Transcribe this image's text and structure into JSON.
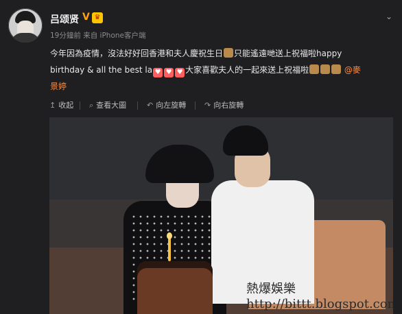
{
  "post": {
    "username": "吕颂贤",
    "verified_mark": "V",
    "crown_badge": "♛",
    "meta": "19分鐘前 来自 iPhone客户端",
    "chevron": "⌄",
    "content": {
      "line1": "今年因為疫情，沒法好好回香港和夫人慶祝生日",
      "line1b": "只能遙遠哋送上祝福啦happy",
      "line2a": "birthday & all the best la",
      "line2b": "大家喜歡夫人的一起來送上祝福啦",
      "mention": "@麥",
      "line3": "景婷"
    }
  },
  "actions": {
    "collapse": "收起",
    "view_large": "查看大圖",
    "rotate_left": "向左旋轉",
    "rotate_right": "向右旋轉"
  },
  "photo": {
    "watermark_title": "熱爆娛樂",
    "watermark_url": "http://bittt.blogspot.com"
  },
  "colors": {
    "background": "#1f1f21",
    "mention": "#ff8a3d",
    "verified": "#ffa11a"
  },
  "icons": {
    "collapse": "arrow-up-icon",
    "view_large": "zoom-icon",
    "rotate_left": "rotate-left-icon",
    "rotate_right": "rotate-right-icon",
    "chevron": "chevron-down-icon"
  }
}
